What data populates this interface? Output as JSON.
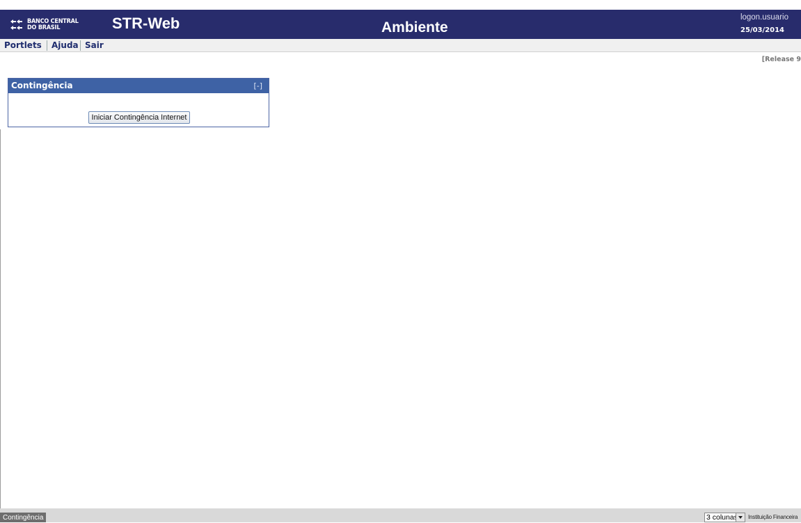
{
  "header": {
    "logo_text": "BANCO CENTRAL",
    "logo_text_2": "DO BRASIL",
    "app_title": "STR-Web",
    "environment_title": "Ambiente",
    "user": "logon.usuario",
    "date": "25/03/2014"
  },
  "menu": {
    "items": [
      {
        "label": "Portlets"
      },
      {
        "label": "Ajuda"
      },
      {
        "label": "Sair"
      }
    ]
  },
  "release_label": "[Release 9",
  "portlet": {
    "title": "Contingência",
    "collapse_label": "[-]",
    "button_label": "Iniciar Contingência Internet"
  },
  "footer": {
    "tab_label": "Contingência",
    "columns_select_value": "3 colunas",
    "institution_label": "Instituição Financeira"
  },
  "colors": {
    "header_bg": "#282c6c",
    "portlet_header_bg": "#3e62a5"
  }
}
